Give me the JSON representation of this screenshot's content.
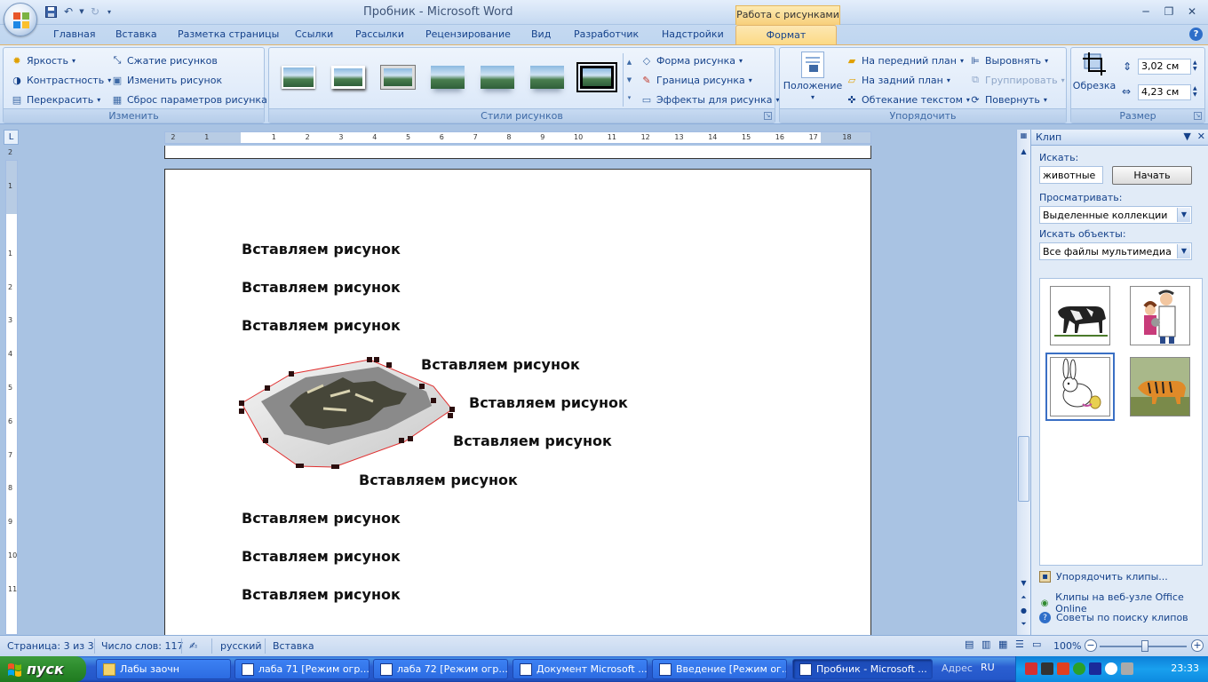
{
  "window": {
    "title": "Пробник - Microsoft Word",
    "tools_title": "Работа с рисунками"
  },
  "tabs": [
    "Главная",
    "Вставка",
    "Разметка страницы",
    "Ссылки",
    "Рассылки",
    "Рецензирование",
    "Вид",
    "Разработчик",
    "Надстройки",
    "Формат"
  ],
  "ribbon": {
    "adjust": {
      "label": "Изменить",
      "brightness": "Яркость",
      "contrast": "Контрастность",
      "recolor": "Перекрасить",
      "compress": "Сжатие рисунков",
      "change": "Изменить рисунок",
      "reset": "Сброс параметров рисунка"
    },
    "styles": {
      "label": "Стили рисунков",
      "shape": "Форма рисунка",
      "border": "Граница рисунка",
      "effects": "Эффекты для рисунка"
    },
    "arrange": {
      "label": "Упорядочить",
      "position": "Положение",
      "front": "На передний план",
      "back": "На задний план",
      "wrap": "Обтекание текстом",
      "align": "Выровнять",
      "group": "Группировать",
      "rotate": "Повернуть"
    },
    "size": {
      "label": "Размер",
      "crop": "Обрезка",
      "height": "3,02 см",
      "width": "4,23 см"
    }
  },
  "document": {
    "lines": [
      "Вставляем рисунок",
      "Вставляем рисунок",
      "Вставляем рисунок",
      "Вставляем рисунок",
      "Вставляем рисунок",
      "Вставляем рисунок",
      "Вставляем рисунок",
      "Вставляем рисунок",
      "Вставляем рисунок",
      "Вставляем рисунок"
    ]
  },
  "ruler": {
    "h_labels": [
      "2",
      "1",
      "1",
      "2",
      "3",
      "4",
      "5",
      "6",
      "7",
      "8",
      "9",
      "10",
      "11",
      "12",
      "13",
      "14",
      "15",
      "16",
      "17",
      "18"
    ],
    "v_labels": [
      "2",
      "1",
      "1",
      "2",
      "3",
      "4",
      "5",
      "6",
      "7",
      "8",
      "9",
      "10",
      "11"
    ]
  },
  "taskpane": {
    "title": "Клип",
    "search_label": "Искать:",
    "search_value": "животные",
    "go": "Начать",
    "browse_label": "Просматривать:",
    "browse_value": "Выделенные коллекции",
    "type_label": "Искать объекты:",
    "type_value": "Все файлы мультимедиа",
    "link1": "Упорядочить клипы...",
    "link2": "Клипы на веб-узле Office Online",
    "link3": "Советы по поиску клипов"
  },
  "status": {
    "page": "Страница: 3 из 3",
    "words": "Число слов: 117",
    "lang": "русский",
    "mode": "Вставка",
    "zoom": "100%"
  },
  "taskbar": {
    "start": "пуск",
    "items": [
      "Лабы заочн",
      "лаба 71 [Режим огр...",
      "лаба 72 [Режим огр...",
      "Документ Microsoft ...",
      "Введение [Режим ог...",
      "Пробник - Microsoft ..."
    ],
    "address": "Адрес",
    "lang": "RU",
    "clock": "23:33"
  },
  "colors": {
    "ribbon_bg": "#dbe8f8",
    "accent_tab": "#fbd983",
    "selection_outline": "#e03030",
    "taskbar": "#2457c9"
  }
}
